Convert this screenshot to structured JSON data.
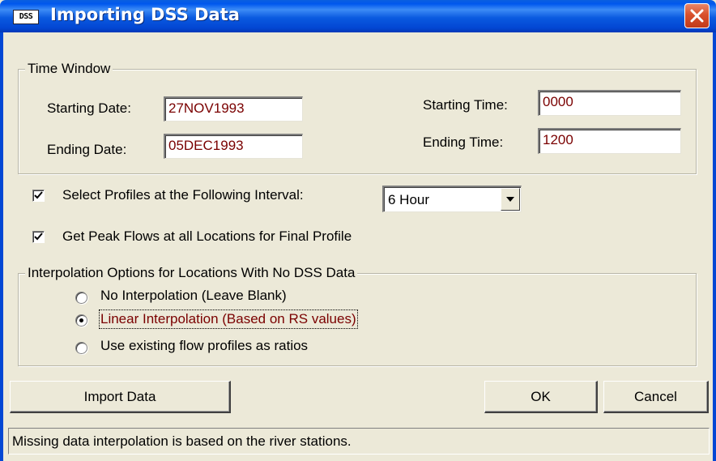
{
  "window": {
    "title": "Importing DSS Data",
    "icon_label": "DSS",
    "icon": "dss-app-icon",
    "close_icon": "close-icon"
  },
  "time_window": {
    "legend": "Time Window",
    "starting_date_label": "Starting Date:",
    "starting_date": "27NOV1993",
    "ending_date_label": "Ending Date:",
    "ending_date": "05DEC1993",
    "starting_time_label": "Starting Time:",
    "starting_time": "0000",
    "ending_time_label": "Ending Time:",
    "ending_time": "1200"
  },
  "profiles": {
    "select_interval_label": "Select Profiles at the Following Interval:",
    "select_interval_checked": true,
    "interval_value": "6 Hour",
    "peak_flows_label": "Get Peak Flows at all Locations for Final Profile",
    "peak_flows_checked": true
  },
  "interpolation": {
    "legend": "Interpolation Options for Locations With No DSS Data",
    "options": [
      {
        "label": "No Interpolation (Leave Blank)",
        "selected": false
      },
      {
        "label": "Linear Interpolation (Based on RS values)",
        "selected": true
      },
      {
        "label": "Use existing flow profiles as ratios",
        "selected": false
      }
    ]
  },
  "buttons": {
    "import": "Import Data",
    "ok": "OK",
    "cancel": "Cancel"
  },
  "status": {
    "message": "Missing data interpolation is based on the river stations."
  },
  "colors": {
    "field_text": "#7a0000",
    "title_bar": "#0058ee",
    "dialog_bg": "#ece9d8"
  }
}
